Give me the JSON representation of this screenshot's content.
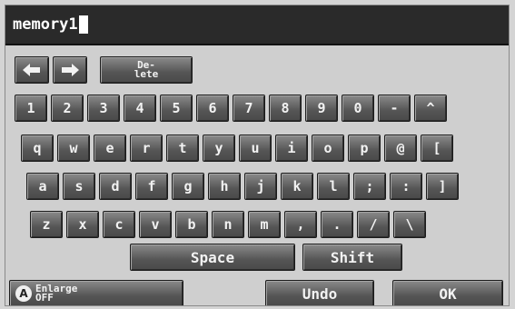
{
  "input": {
    "value": "memory1"
  },
  "nav_keys": {
    "left_icon": "arrow-left-icon",
    "right_icon": "arrow-right-icon",
    "delete_line1": "De-",
    "delete_line2": "lete"
  },
  "rows": {
    "row1": [
      "1",
      "2",
      "3",
      "4",
      "5",
      "6",
      "7",
      "8",
      "9",
      "0",
      "-",
      "^"
    ],
    "row2": [
      "q",
      "w",
      "e",
      "r",
      "t",
      "y",
      "u",
      "i",
      "o",
      "p",
      "@",
      "["
    ],
    "row3": [
      "a",
      "s",
      "d",
      "f",
      "g",
      "h",
      "j",
      "k",
      "l",
      ";",
      ":",
      "]"
    ],
    "row4": [
      "z",
      "x",
      "c",
      "v",
      "b",
      "n",
      "m",
      ",",
      ".",
      "/",
      "\\"
    ]
  },
  "space_label": "Space",
  "shift_label": "Shift",
  "enlarge": {
    "icon": "enlarge-icon",
    "icon_glyph": "A",
    "line1": "Enlarge",
    "line2": "OFF"
  },
  "undo_label": "Undo",
  "ok_label": "OK",
  "colors": {
    "input_bar": "#2a2a2a",
    "key": "#555555",
    "background": "#cfcfcf"
  }
}
